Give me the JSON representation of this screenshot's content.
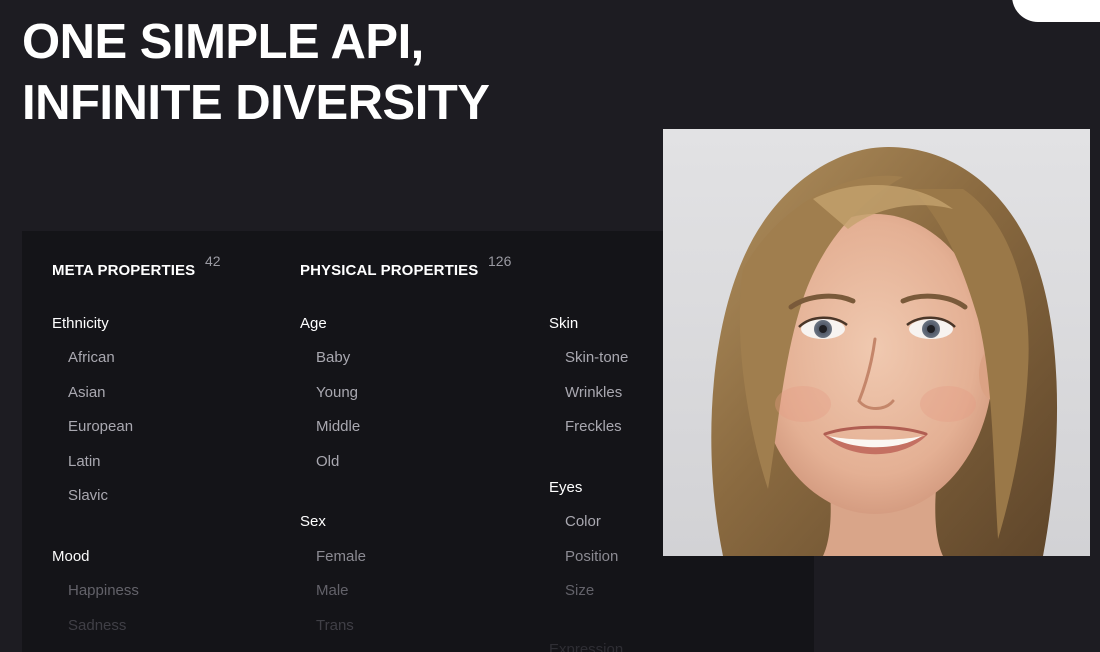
{
  "headline": {
    "line1": "ONE SIMPLE API,",
    "line2": "INFINITE DIVERSITY"
  },
  "meta": {
    "title": "META PROPERTIES",
    "count": "42",
    "groups": {
      "ethnicity": {
        "label": "Ethnicity",
        "items": [
          "African",
          "Asian",
          "European",
          "Latin",
          "Slavic"
        ]
      },
      "mood": {
        "label": "Mood",
        "items": [
          "Happiness",
          "Sadness"
        ]
      }
    }
  },
  "physical": {
    "title": "PHYSICAL PROPERTIES",
    "count": "126",
    "groups": {
      "age": {
        "label": "Age",
        "items": [
          "Baby",
          "Young",
          "Middle",
          "Old"
        ]
      },
      "sex": {
        "label": "Sex",
        "items": [
          "Female",
          "Male",
          "Trans"
        ]
      },
      "skin": {
        "label": "Skin",
        "items": [
          "Skin-tone",
          "Wrinkles",
          "Freckles"
        ]
      },
      "eyes": {
        "label": "Eyes",
        "items": [
          "Color",
          "Position",
          "Size"
        ]
      },
      "expression": {
        "label": "Expression"
      }
    }
  },
  "colors": {
    "background": "#1d1c22",
    "panel": "#141418",
    "heading": "#ffffff",
    "item_text": "#a9a8b0",
    "count_text": "#9a9aa2"
  }
}
